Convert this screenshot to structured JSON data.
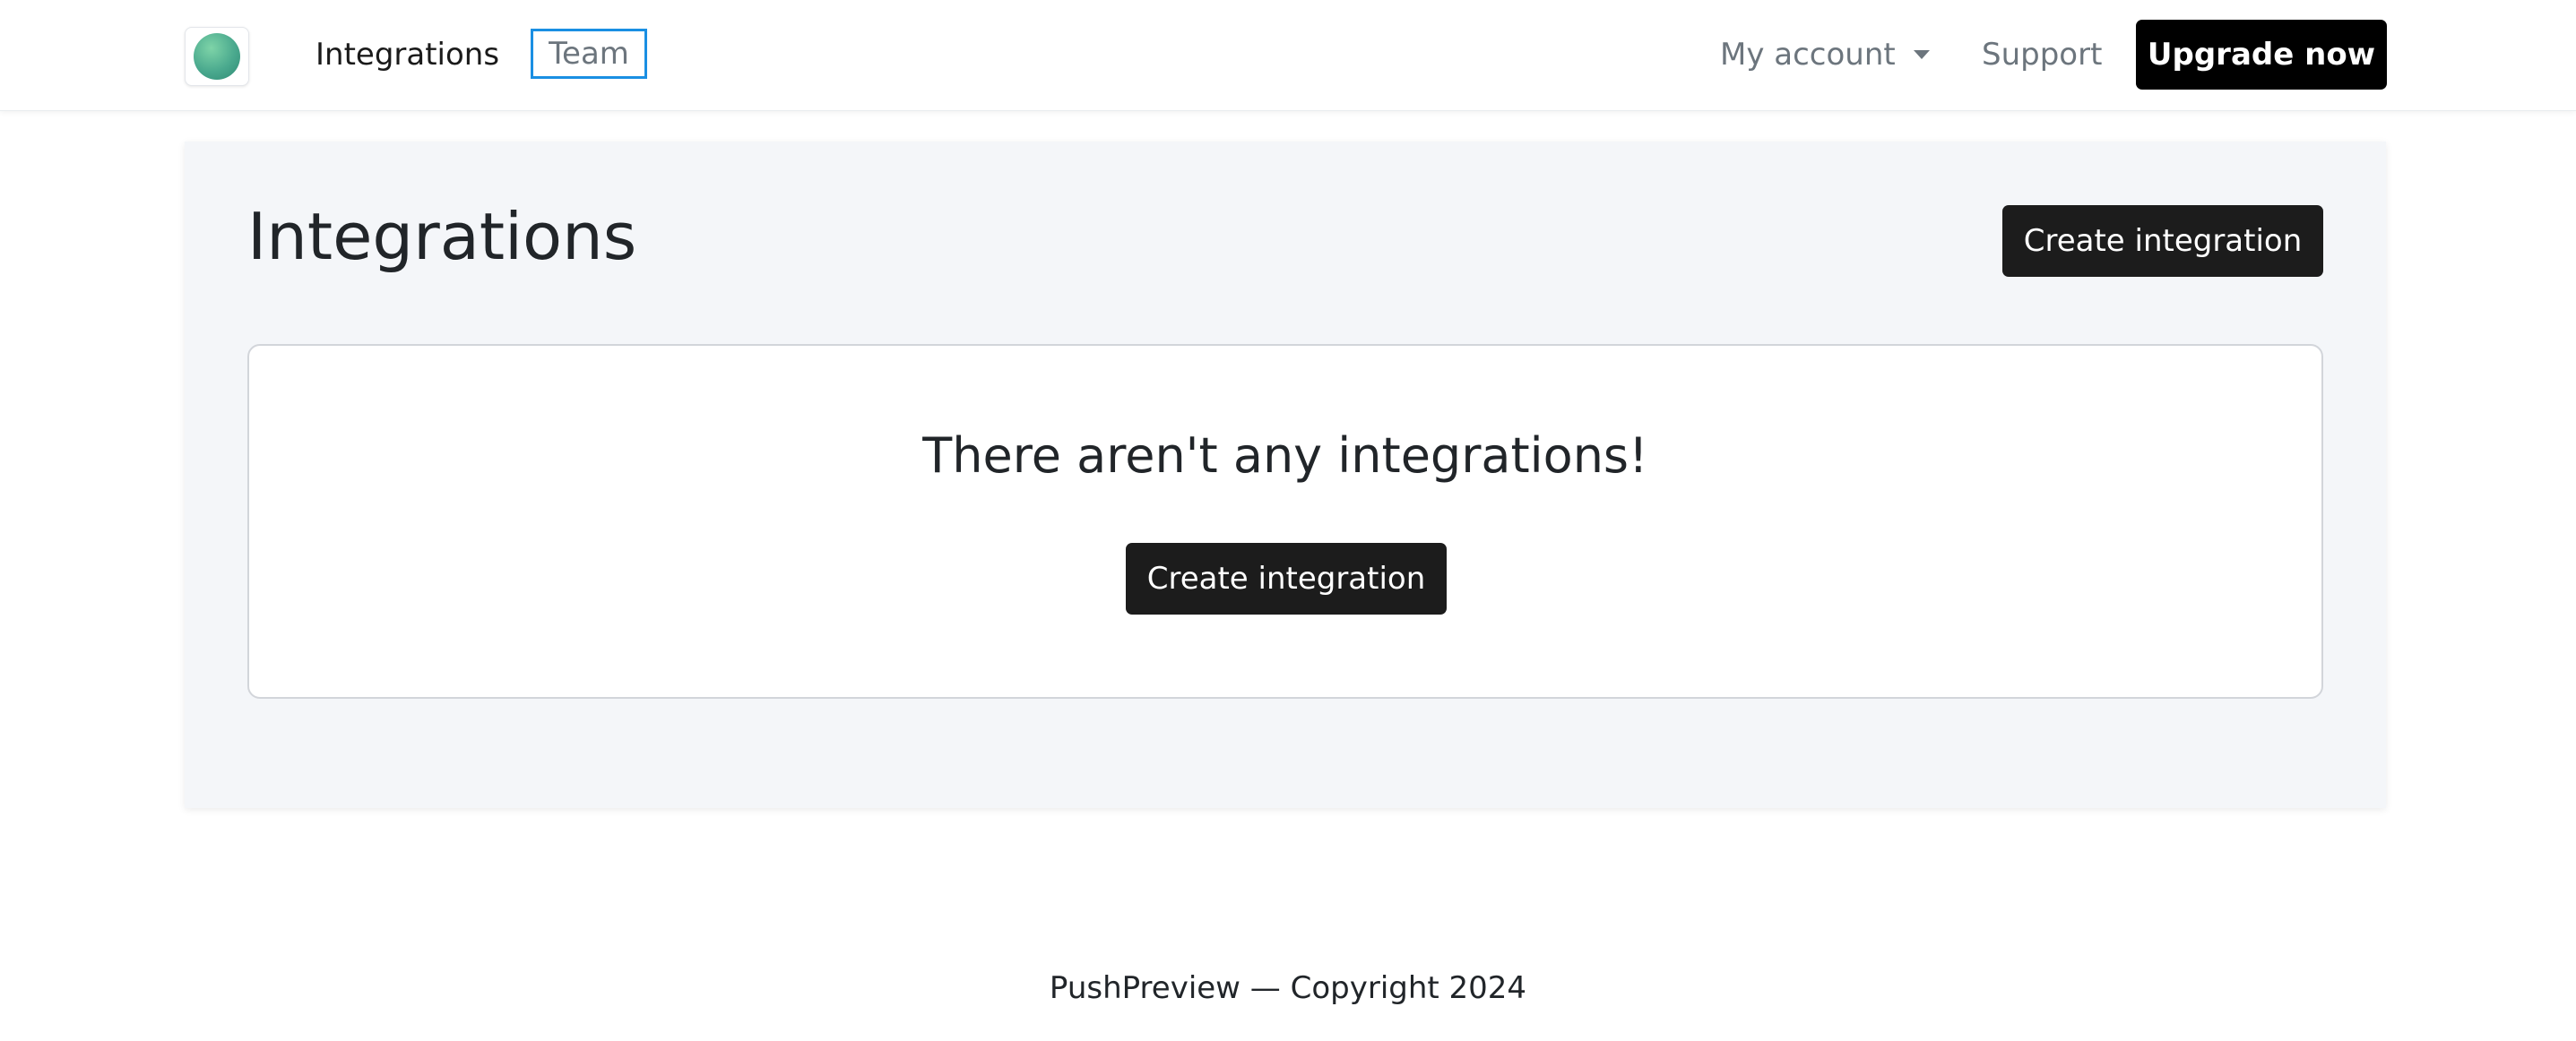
{
  "nav": {
    "logo_icon": "app-logo-icon",
    "links": {
      "integrations": "Integrations",
      "team": "Team"
    },
    "my_account": "My account",
    "support": "Support",
    "upgrade_button": "Upgrade now"
  },
  "main": {
    "title": "Integrations",
    "create_button": "Create integration",
    "empty_state": {
      "message": "There aren't any integrations!",
      "create_button": "Create integration"
    }
  },
  "footer": {
    "text": "PushPreview — Copyright 2024"
  },
  "colors": {
    "accent_focus": "#1a8fe3",
    "primary_button": "#1c1c1c",
    "upgrade_button": "#000000",
    "panel_background": "#f4f6f9",
    "logo_green": "#4aa98e"
  }
}
